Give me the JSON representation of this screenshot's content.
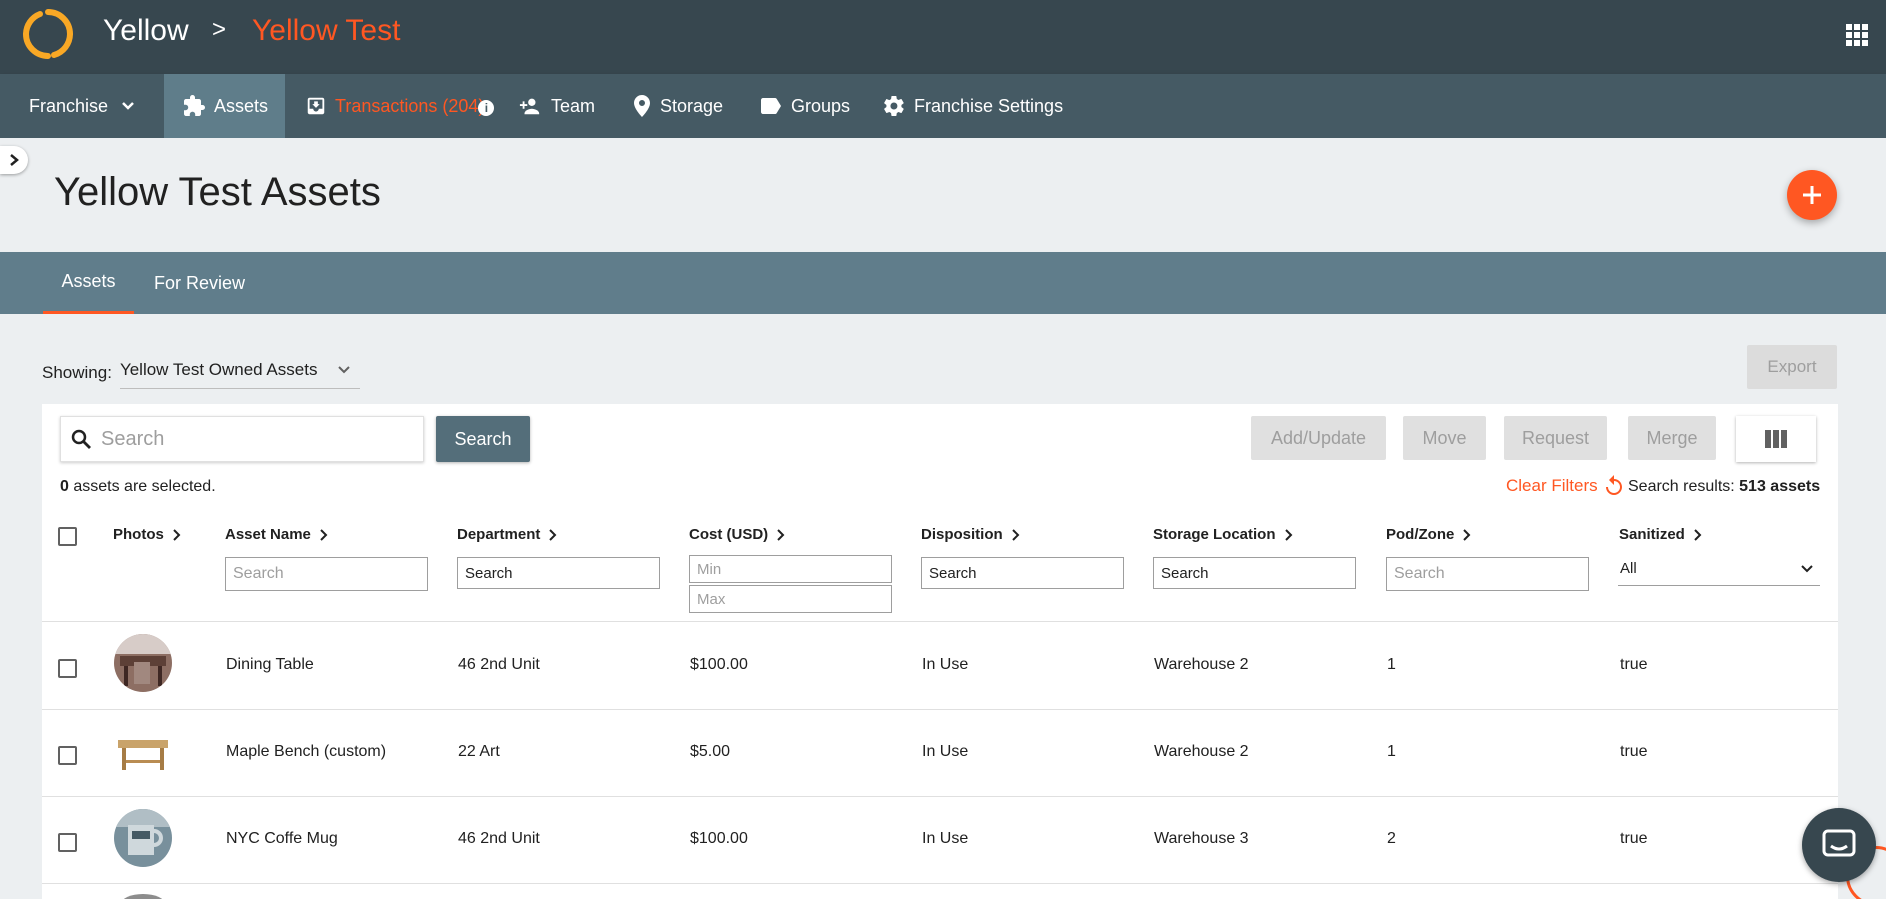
{
  "header": {
    "org": "Yellow",
    "separator": ">",
    "current": "Yellow Test"
  },
  "nav": {
    "franchise_label": "Franchise",
    "items": [
      {
        "label": "Assets",
        "icon": "puzzle-icon",
        "active": true
      },
      {
        "label": "Transactions (204)",
        "icon": "inbox-icon",
        "alert": true
      },
      {
        "label": "Team",
        "icon": "person-add-icon"
      },
      {
        "label": "Storage",
        "icon": "location-pin-icon"
      },
      {
        "label": "Groups",
        "icon": "label-tag-icon"
      },
      {
        "label": "Franchise Settings",
        "icon": "gear-icon"
      }
    ],
    "info_glyph": "i"
  },
  "page": {
    "title": "Yellow Test Assets"
  },
  "tabs": [
    {
      "label": "Assets",
      "active": true
    },
    {
      "label": "For Review",
      "active": false
    }
  ],
  "showing": {
    "label": "Showing:",
    "value": "Yellow Test Owned Assets"
  },
  "toolbar": {
    "export": "Export",
    "search_placeholder": "Search",
    "search_button": "Search",
    "add_update": "Add/Update",
    "move": "Move",
    "request": "Request",
    "merge": "Merge"
  },
  "status": {
    "selected_count": "0",
    "selected_suffix": " assets are selected.",
    "clear_filters": "Clear Filters",
    "results_label": "Search results: ",
    "results_value": "513 assets"
  },
  "columns": {
    "photos": "Photos",
    "asset_name": "Asset Name",
    "department": "Department",
    "cost": "Cost (USD)",
    "disposition": "Disposition",
    "storage_location": "Storage Location",
    "pod_zone": "Pod/Zone",
    "sanitized": "Sanitized"
  },
  "filters": {
    "asset_name_placeholder": "Search",
    "department_placeholder": "Search",
    "cost_min_placeholder": "Min",
    "cost_max_placeholder": "Max",
    "disposition_placeholder": "Search",
    "storage_placeholder": "Search",
    "pod_placeholder": "Search",
    "sanitized_value": "All"
  },
  "rows": [
    {
      "name": "Dining Table",
      "department": "46 2nd Unit",
      "cost": "$100.00",
      "disposition": "In Use",
      "storage": "Warehouse 2",
      "pod": "1",
      "sanitized": "true"
    },
    {
      "name": "Maple Bench (custom)",
      "department": "22 Art",
      "cost": "$5.00",
      "disposition": "In Use",
      "storage": "Warehouse 2",
      "pod": "1",
      "sanitized": "true"
    },
    {
      "name": "NYC Coffe Mug",
      "department": "46 2nd Unit",
      "cost": "$100.00",
      "disposition": "In Use",
      "storage": "Warehouse 3",
      "pod": "2",
      "sanitized": "true"
    }
  ],
  "colors": {
    "accent": "#ff5722",
    "header_bg": "#37474f",
    "nav_bg": "#455a64",
    "tabs_bg": "#607d8b",
    "logo": "#f9a825"
  }
}
